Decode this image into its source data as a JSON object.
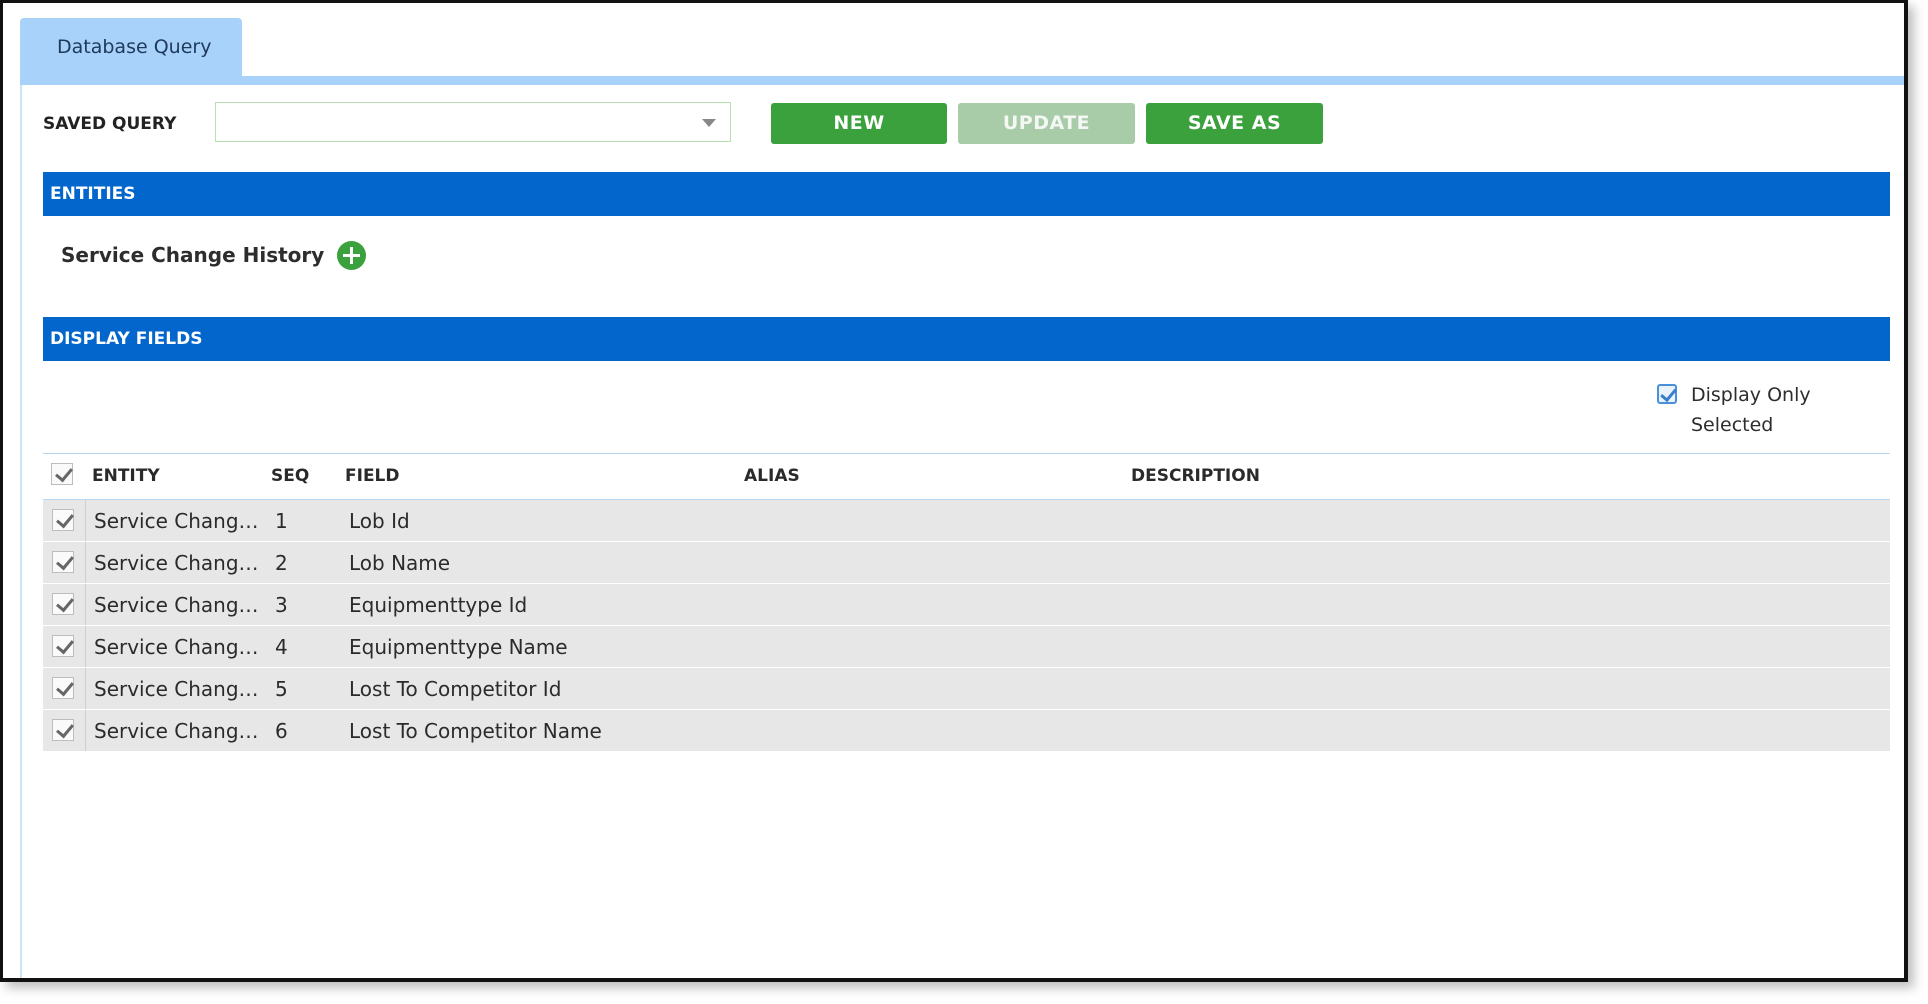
{
  "tab": {
    "label": "Database Query"
  },
  "toolbar": {
    "saved_query_label": "SAVED QUERY",
    "saved_query_value": "",
    "new_label": "NEW",
    "update_label": "UPDATE",
    "save_as_label": "SAVE AS"
  },
  "entities_section": {
    "title": "ENTITIES",
    "entity_name": "Service Change History"
  },
  "display_fields_section": {
    "title": "DISPLAY FIELDS",
    "display_only_selected_line1": "Display Only",
    "display_only_selected_line2": "Selected",
    "display_only_selected_checked": true
  },
  "grid": {
    "headers": {
      "entity": "ENTITY",
      "seq": "SEQ",
      "field": "FIELD",
      "alias": "ALIAS",
      "description": "DESCRIPTION"
    },
    "rows": [
      {
        "checked": true,
        "entity": "Service Change…",
        "seq": "1",
        "field": "Lob Id",
        "alias": "",
        "description": ""
      },
      {
        "checked": true,
        "entity": "Service Change…",
        "seq": "2",
        "field": "Lob Name",
        "alias": "",
        "description": ""
      },
      {
        "checked": true,
        "entity": "Service Change…",
        "seq": "3",
        "field": "Equipmenttype Id",
        "alias": "",
        "description": ""
      },
      {
        "checked": true,
        "entity": "Service Change…",
        "seq": "4",
        "field": "Equipmenttype Name",
        "alias": "",
        "description": ""
      },
      {
        "checked": true,
        "entity": "Service Change…",
        "seq": "5",
        "field": "Lost To Competitor Id",
        "alias": "",
        "description": ""
      },
      {
        "checked": true,
        "entity": "Service Change…",
        "seq": "6",
        "field": "Lost To Competitor Name",
        "alias": "",
        "description": ""
      }
    ]
  },
  "colors": {
    "tab_bg": "#a8d2f9",
    "section_bg": "#0366cc",
    "button_green": "#3aa13d",
    "button_disabled": "#a9cca8",
    "row_bg": "#e7e7e7"
  },
  "icons": {
    "add_entity": "plus-circle-icon",
    "select_caret": "chevron-down-icon"
  }
}
